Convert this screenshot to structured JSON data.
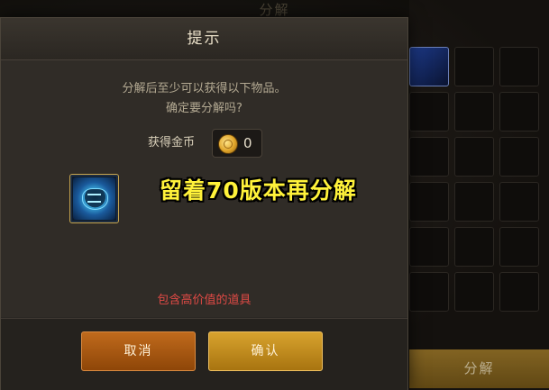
{
  "background": {
    "title": "分解",
    "decompose_button_label": "分解"
  },
  "dialog": {
    "title": "提示",
    "message_line1": "分解后至少可以获得以下物品。",
    "message_line2": "确定要分解吗?",
    "gold_label": "获得金币",
    "gold_value": "0",
    "item_icon": "blue-orb-item-icon",
    "overlay_caption": "留着70版本再分解",
    "warning": "包含高价值的道具",
    "cancel_label": "取消",
    "confirm_label": "确认"
  },
  "colors": {
    "warning": "#e04a45",
    "overlay_caption": "#fff23a",
    "cancel_button": "#b35f16",
    "confirm_button": "#c99224"
  }
}
